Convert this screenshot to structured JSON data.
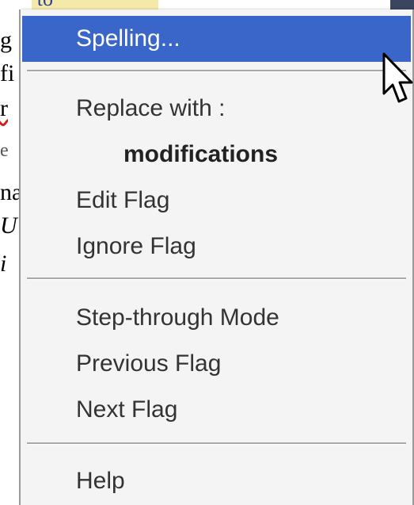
{
  "background_document": {
    "top_text": "ate to",
    "lines": [
      "g",
      "fi",
      "r",
      "e",
      "na",
      "U",
      "i"
    ]
  },
  "context_menu": {
    "spelling_label": "Spelling...",
    "replace_with_label": "Replace with :",
    "suggestion": "modifications",
    "edit_flag_label": "Edit Flag",
    "ignore_flag_label": "Ignore Flag",
    "step_through_label": "Step-through Mode",
    "previous_flag_label": "Previous Flag",
    "next_flag_label": "Next Flag",
    "help_label": "Help",
    "highlight_color": "#3966c8"
  },
  "cursor": {
    "icon": "arrow-pointer-icon"
  }
}
